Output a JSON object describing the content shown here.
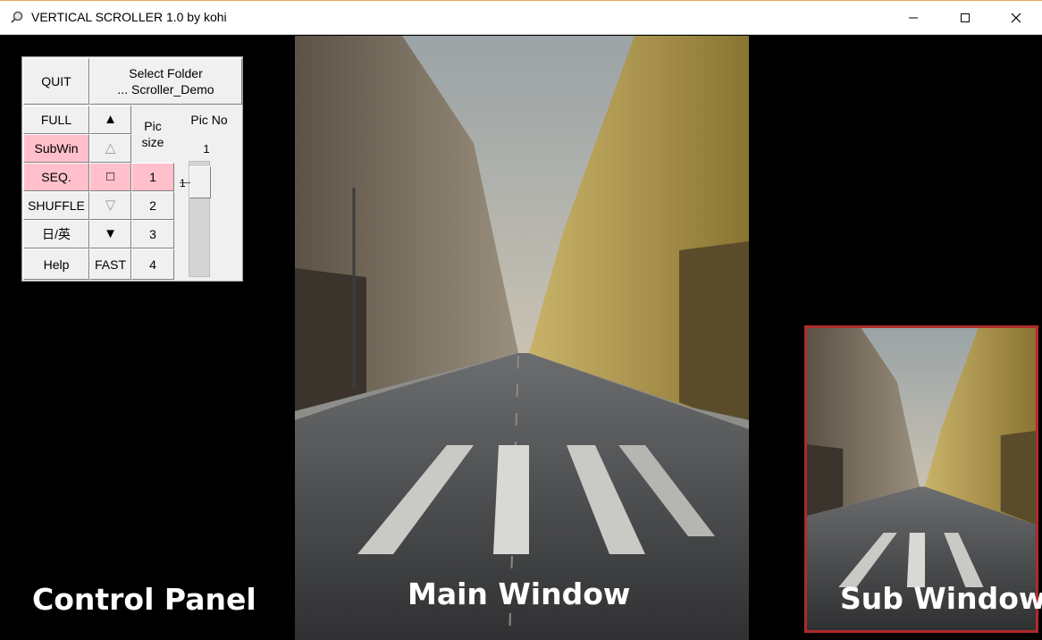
{
  "window": {
    "title": "VERTICAL SCROLLER 1.0 by kohi",
    "icon": "magnifier-icon",
    "controls": [
      "minimize-icon",
      "maximize-icon",
      "close-icon"
    ]
  },
  "control_panel": {
    "quit": "QUIT",
    "select_folder_line1": "Select Folder",
    "select_folder_line2": "... Scroller_Demo",
    "full": "FULL",
    "subwin": "SubWin",
    "seq": "SEQ.",
    "shuffle": "SHUFFLE",
    "lang": "日/英",
    "help": "Help",
    "fast": "FAST",
    "arrow_up_filled": "▲",
    "arrow_up_outline": "△",
    "stop_square": "□",
    "arrow_down_outline": "▽",
    "arrow_down_filled": "▼",
    "pic_size_line1": "Pic",
    "pic_size_line2": "size",
    "size_1": "1",
    "size_2": "2",
    "size_3": "3",
    "size_4": "4",
    "pic_no_label": "Pic No",
    "pic_no_value": "1",
    "slider_value": "1",
    "active_color": "#ffc0cb"
  },
  "captions": {
    "control_panel": "Control Panel",
    "main_window": "Main Window",
    "sub_window": "Sub Window"
  },
  "sub_window_border_color": "#b02a2a"
}
